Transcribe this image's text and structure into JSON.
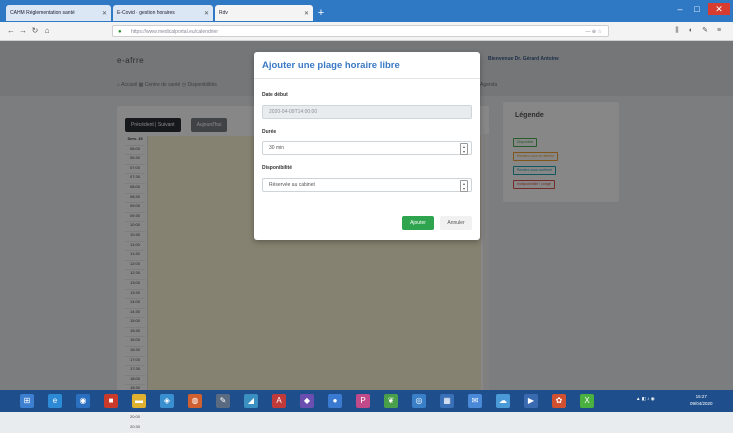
{
  "browser": {
    "tabs": [
      {
        "label": "CAHM Réglementation santé",
        "active": false
      },
      {
        "label": "E-Covid · gestion horaires",
        "active": false
      },
      {
        "label": "Rdv",
        "active": true
      }
    ],
    "url": "https://www.medicalportal.eu/calendrier",
    "search_text": "— ⊕ ☆"
  },
  "page": {
    "logo": "e-afrre",
    "menu_text": "⌂ Accueil    ▦ Centre de santé    ◷ Disponibilités",
    "right_nav": "Agenda",
    "user_name": "Bienvenue Dr. Gérard Antoine"
  },
  "calendar": {
    "btn_previous": "Précédent",
    "btn_next": "Suivant",
    "btn_today": "Aujourd'hui",
    "header": "Sem. 15",
    "times": [
      "06:00",
      "06:30",
      "07:00",
      "07:30",
      "08:00",
      "08:30",
      "09:00",
      "09:30",
      "10:00",
      "10:30",
      "11:00",
      "11:30",
      "12:00",
      "12:30",
      "13:00",
      "13:30",
      "14:00",
      "14:30",
      "15:00",
      "15:30",
      "16:00",
      "16:30",
      "17:00",
      "17:30",
      "18:00",
      "18:30",
      "19:00",
      "19:30",
      "20:00",
      "20:30"
    ]
  },
  "legend": {
    "title": "Légende",
    "items": [
      {
        "label": "Disponible",
        "color": "#4caf50"
      },
      {
        "label": "Rendez-vous en attente",
        "color": "#f0a030"
      },
      {
        "label": "Rendez-vous confirmé",
        "color": "#20a0b0"
      },
      {
        "label": "Indisponibilité / congé",
        "color": "#d9534f"
      }
    ]
  },
  "modal": {
    "title": "Ajouter une plage horaire libre",
    "date_label": "Date début",
    "date_value": "2020-04-09T14:00:00",
    "duration_label": "Durée",
    "duration_value": "30 min",
    "availability_label": "Disponibilité",
    "availability_value": "Réservée au cabinet",
    "btn_add": "Ajouter",
    "btn_cancel": "Annuler"
  },
  "taskbar": {
    "time": "15:27",
    "date": "09/04/2020"
  }
}
